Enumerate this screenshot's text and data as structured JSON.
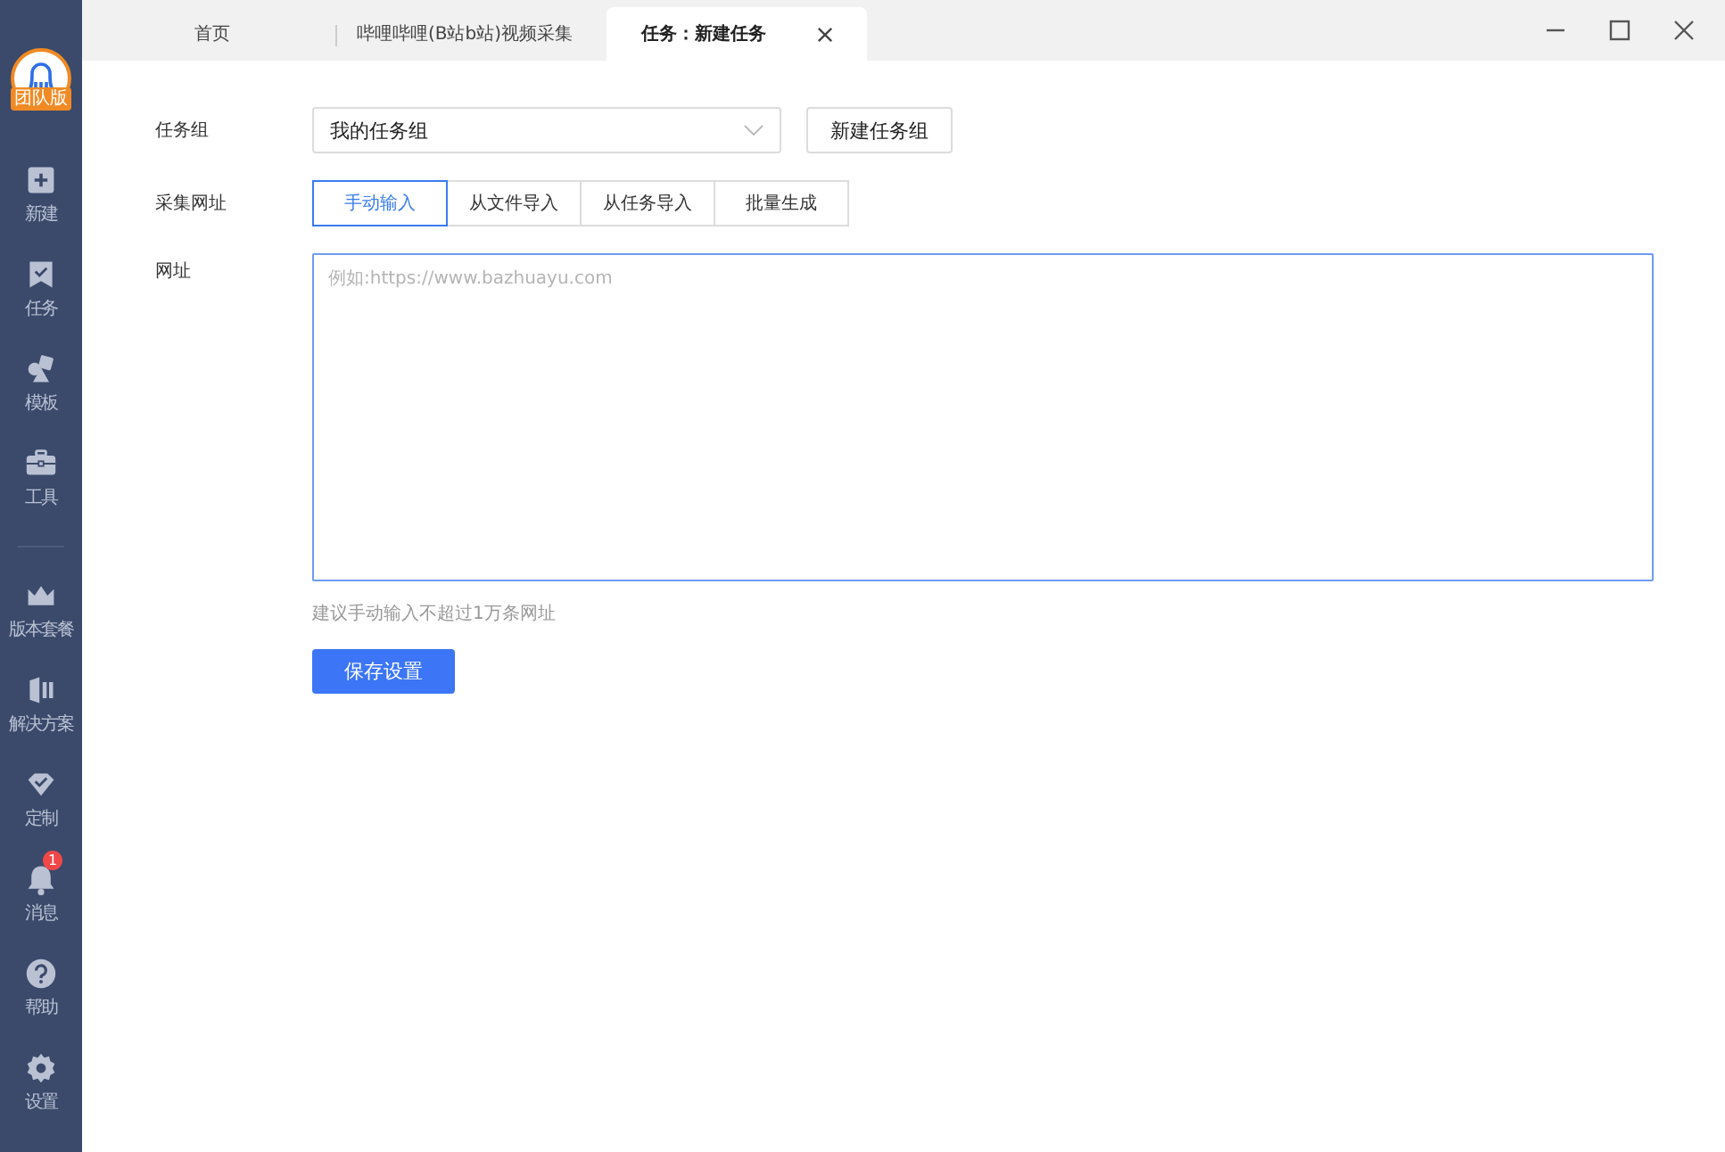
{
  "sidebar": {
    "logo_badge": "团队版",
    "items": [
      {
        "label": "新建"
      },
      {
        "label": "任务"
      },
      {
        "label": "模板"
      },
      {
        "label": "工具"
      },
      {
        "label": "版本套餐",
        "group_start": true
      },
      {
        "label": "解决方案"
      },
      {
        "label": "定制"
      },
      {
        "label": "消息",
        "badge": "1"
      },
      {
        "label": "帮助"
      },
      {
        "label": "设置"
      }
    ]
  },
  "tabs": [
    {
      "label": "首页",
      "selected": false
    },
    {
      "label": "哔哩哔哩(B站b站)视频采集",
      "selected": false
    },
    {
      "label": "任务：新建任务",
      "selected": true
    }
  ],
  "form": {
    "task_group": {
      "label": "任务组",
      "value": "我的任务组",
      "button": "新建任务组"
    },
    "source": {
      "label": "采集网址",
      "options": [
        {
          "label": "手动输入",
          "selected": true
        },
        {
          "label": "从文件导入",
          "selected": false
        },
        {
          "label": "从任务导入",
          "selected": false
        },
        {
          "label": "批量生成",
          "selected": false
        }
      ]
    },
    "url": {
      "label": "网址",
      "placeholder": "例如:https://www.bazhuayu.com"
    },
    "hint": "建议手动输入不超过1万条网址",
    "save_button": "保存设置"
  }
}
